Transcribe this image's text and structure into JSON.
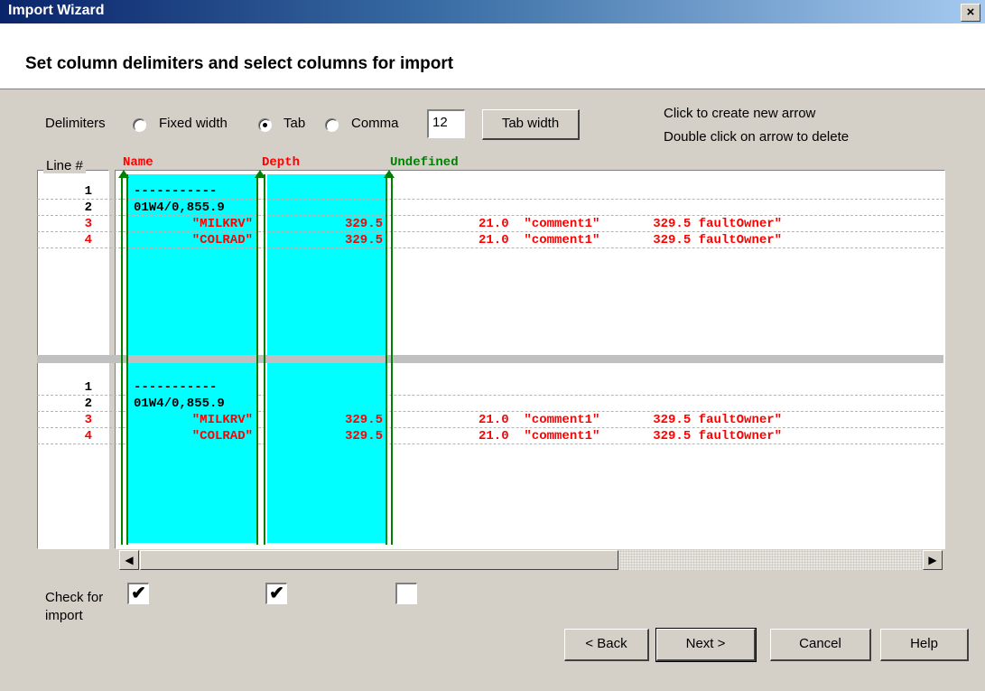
{
  "window": {
    "title": "Import Wizard",
    "close_label": "×",
    "header": "Set column delimiters and select columns for import"
  },
  "delimiters": {
    "label": "Delimiters",
    "options": [
      {
        "label": "Fixed width",
        "selected": false
      },
      {
        "label": "Tab",
        "selected": true
      },
      {
        "label": "Comma",
        "selected": false
      }
    ],
    "tab_width_value": "12",
    "tab_width_button": "Tab width"
  },
  "hints": [
    "Click to create new arrow",
    "Double click on arrow to delete"
  ],
  "columns": [
    {
      "label": "Name",
      "color": "#ff0000",
      "checked": true
    },
    {
      "label": "Depth",
      "color": "#ff0000",
      "checked": true
    },
    {
      "label": "Undefined",
      "color": "#008000",
      "checked": false
    }
  ],
  "line_header": "Line #",
  "panes": [
    {
      "lines": [
        {
          "num": "1",
          "color": "#000000",
          "name": "-----------",
          "depth": "",
          "rest": ""
        },
        {
          "num": "2",
          "color": "#000000",
          "name": "01W4/0,855.9",
          "depth": "",
          "rest": ""
        },
        {
          "num": "3",
          "color": "#ff0000",
          "name": "\"MILKRV\"",
          "depth": "329.5",
          "rest": "21.0  \"comment1\"       329.5 faultOwner\""
        },
        {
          "num": "4",
          "color": "#ff0000",
          "name": "\"COLRAD\"",
          "depth": "329.5",
          "rest": "21.0  \"comment1\"       329.5 faultOwner\""
        }
      ]
    },
    {
      "lines": [
        {
          "num": "1",
          "color": "#000000",
          "name": "-----------",
          "depth": "",
          "rest": ""
        },
        {
          "num": "2",
          "color": "#000000",
          "name": "01W4/0,855.9",
          "depth": "",
          "rest": ""
        },
        {
          "num": "3",
          "color": "#ff0000",
          "name": "\"MILKRV\"",
          "depth": "329.5",
          "rest": "21.0  \"comment1\"       329.5 faultOwner\""
        },
        {
          "num": "4",
          "color": "#ff0000",
          "name": "\"COLRAD\"",
          "depth": "329.5",
          "rest": "21.0  \"comment1\"       329.5 faultOwner\""
        }
      ]
    }
  ],
  "scroll": {
    "left_arrow": "◀",
    "right_arrow": "▶"
  },
  "check_label": "Check for import",
  "check_mark": "✔",
  "buttons": {
    "back": "< Back",
    "next": "Next >",
    "cancel": "Cancel",
    "help": "Help"
  },
  "colors": {
    "column_fill": "#00ffff",
    "arrow": "#008000",
    "titlebar": "#0a246a"
  }
}
